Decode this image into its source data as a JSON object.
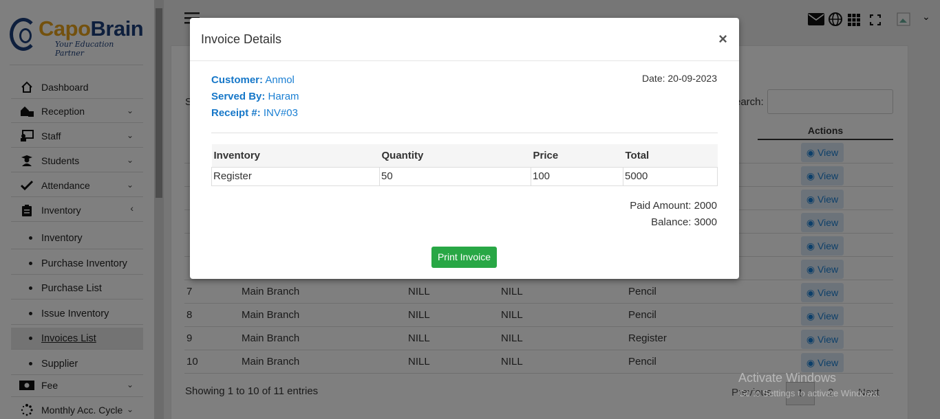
{
  "brand": {
    "name_part1": "Capo",
    "name_part2": "Brain",
    "tagline": "Your Education Partner"
  },
  "sidebar": {
    "items": [
      {
        "label": "Dashboard",
        "icon": "home-icon"
      },
      {
        "label": "Reception",
        "icon": "reception-icon"
      },
      {
        "label": "Staff",
        "icon": "staff-icon"
      },
      {
        "label": "Students",
        "icon": "students-icon"
      },
      {
        "label": "Attendance",
        "icon": "check-icon"
      },
      {
        "label": "Inventory",
        "icon": "clipboard-icon"
      }
    ],
    "inventory_sub": [
      {
        "label": "Inventory"
      },
      {
        "label": "Purchase Inventory"
      },
      {
        "label": "Purchase List"
      },
      {
        "label": "Issue Inventory"
      },
      {
        "label": "Invoices List"
      },
      {
        "label": "Supplier"
      }
    ],
    "bottom_items": [
      {
        "label": "Fee",
        "icon": "money-icon"
      },
      {
        "label": "Monthly Acc. Cycle",
        "icon": "spinner-icon"
      }
    ]
  },
  "background": {
    "search_label": "earch:",
    "actions_header": "Actions",
    "view_label": "View",
    "rows": [
      {
        "no": "7",
        "branch": "Main Branch",
        "c3": "NILL",
        "c4": "NILL",
        "item": "Pencil"
      },
      {
        "no": "8",
        "branch": "Main Branch",
        "c3": "NILL",
        "c4": "NILL",
        "item": "Pencil"
      },
      {
        "no": "9",
        "branch": "Main Branch",
        "c3": "NILL",
        "c4": "NILL",
        "item": "Register"
      },
      {
        "no": "10",
        "branch": "Main Branch",
        "c3": "NILL",
        "c4": "NILL",
        "item": "Pencil"
      }
    ],
    "footer_info": "Showing 1 to 10 of 11 entries",
    "pager": {
      "previous": "Previous",
      "page1": "1",
      "page2": "2",
      "next": "Next"
    }
  },
  "modal": {
    "title": "Invoice Details",
    "close": "×",
    "customer_label": "Customer:",
    "customer_value": "Anmol",
    "served_label": "Served By:",
    "served_value": "Haram",
    "receipt_label": "Receipt #:",
    "receipt_value": "INV#03",
    "date": "Date: 20-09-2023",
    "table": {
      "headers": [
        "Inventory",
        "Quantity",
        "Price",
        "Total"
      ],
      "rows": [
        [
          "Register",
          "50",
          "100",
          "5000"
        ]
      ]
    },
    "paid_amount": "Paid Amount: 2000",
    "balance": "Balance: 3000",
    "print_label": "Print Invoice"
  },
  "watermark": {
    "title": "Activate Windows",
    "subtitle": "Go to Settings to activate Windows."
  }
}
